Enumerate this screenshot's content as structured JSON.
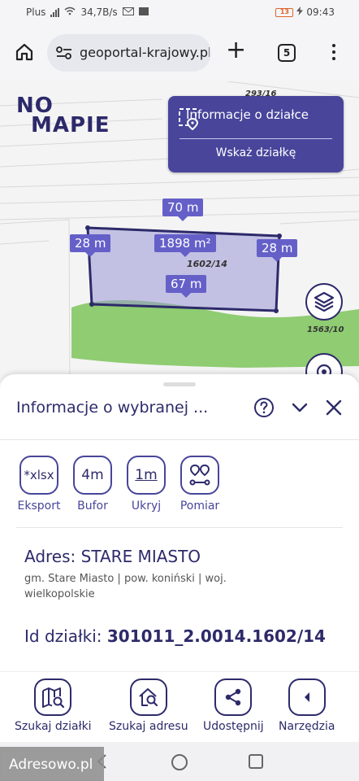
{
  "status_bar": {
    "carrier": "Plus",
    "speed": "34,7B/s",
    "battery": "13",
    "time": "09:43"
  },
  "browser": {
    "url": "geoportal-krajowy.pl",
    "tab_count": "5"
  },
  "map": {
    "logo_line1": "NO",
    "logo_line2": "MAPIE",
    "info_button": "Informacje o działce",
    "point_button": "Wskaż działkę",
    "measure_top": "70 m",
    "measure_left": "28 m",
    "measure_right": "28 m",
    "measure_area": "1898 m²",
    "measure_bottom": "67 m",
    "parcel_label": "1602/14",
    "parcel_label_top": "293/16",
    "parcel_label_right": "1563/10"
  },
  "sheet": {
    "title": "Informacje o wybranej ...",
    "tools": [
      {
        "icon_text": "*xlsx",
        "label": "Eksport"
      },
      {
        "icon_text": "4m",
        "label": "Bufor"
      },
      {
        "icon_text": "1m",
        "label": "Ukryj"
      },
      {
        "icon_text": "",
        "label": "Pomiar"
      }
    ],
    "address_title": "Adres: STARE MIASTO",
    "address_detail": "gm. Stare Miasto | pow. koniński | woj. wielkopolskie",
    "id_label": "Id działki:",
    "id_value": "301011_2.0014.1602/14"
  },
  "bottom_nav": [
    {
      "label": "Szukaj działki",
      "icon": "map-search-icon"
    },
    {
      "label": "Szukaj adresu",
      "icon": "home-search-icon"
    },
    {
      "label": "Udostępnij",
      "icon": "share-icon"
    },
    {
      "label": "Narzędzia",
      "icon": "chevron-left-icon"
    }
  ],
  "watermark": "Adresowo.pl",
  "colors": {
    "brand": "#2d2a6a",
    "panel": "#48459b",
    "label_bg": "#6560c8",
    "parcel_fill": "#9b98d6",
    "field_green": "#7cc45b"
  }
}
